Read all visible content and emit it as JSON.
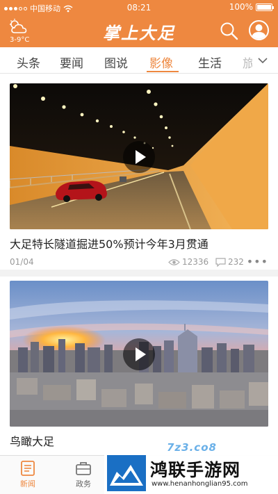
{
  "status_bar": {
    "carrier": "中国移动",
    "time": "08:21",
    "battery": "100%"
  },
  "header": {
    "weather_temp": "3-9°C",
    "logo": "掌上大足",
    "weather_icon": "cloud-sun-icon",
    "search_icon": "search-icon",
    "user_icon": "user-icon"
  },
  "tabs": [
    {
      "label": "头条"
    },
    {
      "label": "要闻"
    },
    {
      "label": "图说"
    },
    {
      "label": "影像",
      "active": true
    },
    {
      "label": "生活"
    },
    {
      "label": "旅"
    }
  ],
  "feed": [
    {
      "title": "大足特长隧道掘进50%预计今年3月贯通",
      "position": "01/04",
      "views": "12336",
      "comments": "232",
      "more": "•••"
    },
    {
      "title": "鸟瞰大足"
    }
  ],
  "bottom_nav": [
    {
      "label": "新闻",
      "icon": "news-icon",
      "active": true
    },
    {
      "label": "政务",
      "icon": "briefcase-icon"
    }
  ],
  "watermark": {
    "title": "鸿联手游网",
    "url": "www.henanhonglian95.com",
    "small": "7z3.co8"
  },
  "colors": {
    "accent": "#ee8840",
    "text": "#222222",
    "muted": "#999999"
  }
}
